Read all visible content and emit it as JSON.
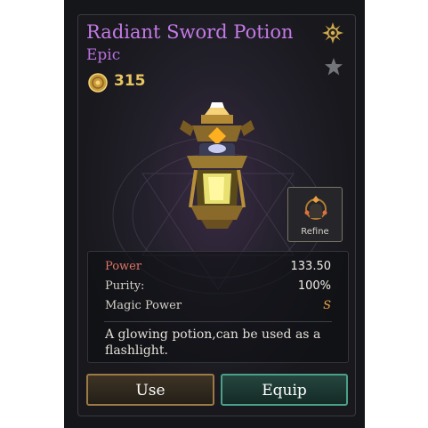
{
  "item": {
    "name": "Radiant Sword Potion",
    "rarity": "Epic",
    "price": "315"
  },
  "actions": {
    "refine_label": "Refine",
    "use_label": "Use",
    "equip_label": "Equip"
  },
  "stats": [
    {
      "label": "Power",
      "value": "133.50"
    },
    {
      "label": "Purity:",
      "value": "100%"
    },
    {
      "label": "Magic Power",
      "value": "S"
    }
  ],
  "description": "A glowing potion,can be used as a flashlight.",
  "icons": {
    "currency": "gold-coin-icon",
    "top_right": "sun-emblem-icon",
    "favorite": "star-icon",
    "refine": "refine-icon"
  },
  "colors": {
    "title": "#c47ae6",
    "price": "#e8c55f",
    "power_label": "#e07565",
    "magic_grade": "#e8a548",
    "use_border": "#9c7a45",
    "equip_border": "#4aa08a"
  }
}
